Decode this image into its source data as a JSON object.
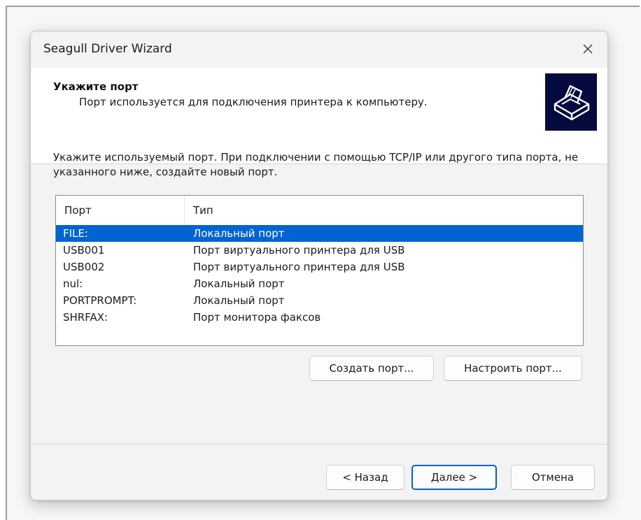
{
  "window": {
    "title": "Seagull Driver Wizard"
  },
  "header": {
    "title": "Укажите порт",
    "subtitle": "Порт используется для подключения принтера к компьютеру.",
    "icon": "printer-icon"
  },
  "instruction": "Укажите используемый порт. При подключении с помощью TCP/IP или другого типа порта, не указанного ниже, создайте новый порт.",
  "port_list": {
    "columns": [
      "Порт",
      "Тип"
    ],
    "rows": [
      {
        "port": "FILE:",
        "type": "Локальный порт",
        "selected": true
      },
      {
        "port": "USB001",
        "type": "Порт виртуального принтера для USB",
        "selected": false
      },
      {
        "port": "USB002",
        "type": "Порт виртуального принтера для USB",
        "selected": false
      },
      {
        "port": "nul:",
        "type": "Локальный порт",
        "selected": false
      },
      {
        "port": "PORTPROMPT:",
        "type": "Локальный порт",
        "selected": false
      },
      {
        "port": "SHRFAX:",
        "type": "Порт монитора факсов",
        "selected": false
      }
    ]
  },
  "port_buttons": {
    "create": "Создать порт...",
    "configure": "Настроить порт..."
  },
  "nav_buttons": {
    "back": "< Назад",
    "next": "Далее >",
    "cancel": "Отмена"
  },
  "colors": {
    "selection": "#0064d2",
    "header_icon_bg": "#050b3f",
    "default_button_border": "#0063c6"
  }
}
